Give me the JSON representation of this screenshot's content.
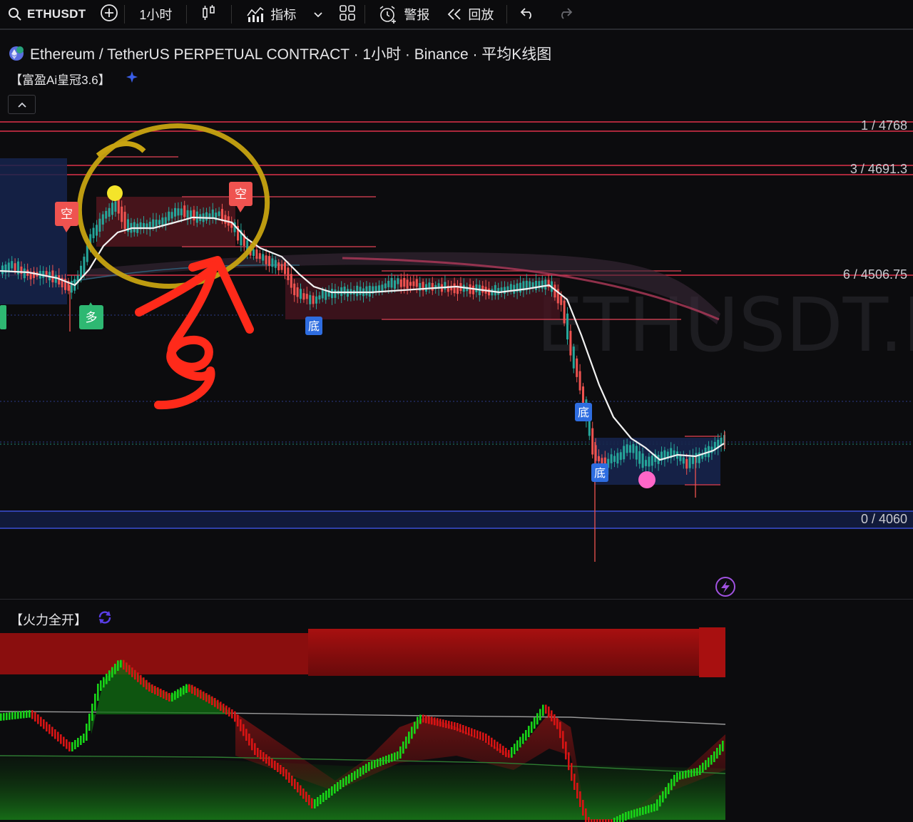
{
  "toolbar": {
    "symbol": "ETHUSDT",
    "interval": "1小时",
    "indicators_label": "指标",
    "alerts_label": "警报",
    "replay_label": "回放"
  },
  "legend": {
    "title": "Ethereum / TetherUS PERPETUAL CONTRACT · 1小时 · Binance · 平均K线图",
    "indicator_main": "【富盈Ai皇冠3.6】",
    "indicator_sub": "【火力全开】"
  },
  "price_levels": [
    {
      "label": "1 / 4768",
      "color": "#e0314a"
    },
    {
      "label": "3 / 4691.3",
      "color": "#e0314a"
    },
    {
      "label": "6 / 4506.75",
      "color": "#e0314a"
    },
    {
      "label": "0 / 4060",
      "color": "#3b4fd6"
    }
  ],
  "signals": {
    "short": "空",
    "long": "多",
    "bottom": "底"
  },
  "watermark": "ETHUSDT.P",
  "colors": {
    "bull": "#26a69a",
    "bear": "#ef5350",
    "osc_green": "#18d418",
    "osc_red": "#d81414",
    "annotation_yellow": "#c7a311",
    "annotation_red": "#ff2a1a"
  }
}
